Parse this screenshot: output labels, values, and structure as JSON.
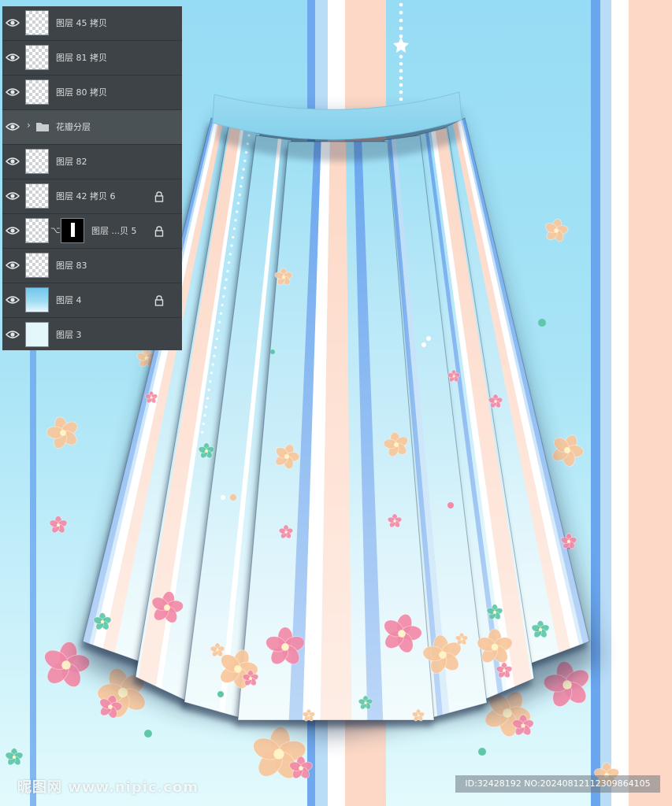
{
  "colors": {
    "sky_blue": "#96dcf4",
    "panel_bg": "#3d4347",
    "stripe_blue": "#6aa6ee",
    "stripe_peach": "#fdd8c6",
    "stripe_white": "#ffffff",
    "flower_pink": "#f28aa8",
    "flower_peach": "#f8c79c",
    "flower_teal": "#5ec7a9"
  },
  "layers_panel": {
    "layers": [
      {
        "name": "图层 45 拷贝",
        "thumbnail": "transparent",
        "locked": false
      },
      {
        "name": "图层 81 拷贝",
        "thumbnail": "transparent",
        "locked": false
      },
      {
        "name": "图层 80 拷贝",
        "thumbnail": "transparent",
        "locked": false
      },
      {
        "name": "花瓣分层",
        "thumbnail": "folder-icon",
        "locked": false,
        "group": true
      },
      {
        "name": "图层 82",
        "thumbnail": "transparent",
        "locked": false
      },
      {
        "name": "图层 42 拷贝 6",
        "thumbnail": "transparent",
        "locked": true
      },
      {
        "name": "图层 ...贝 5",
        "thumbnail": "transparent",
        "locked": true,
        "mask": true
      },
      {
        "name": "图层 83",
        "thumbnail": "transparent",
        "locked": false
      },
      {
        "name": "图层 4",
        "thumbnail": "blue",
        "locked": true
      },
      {
        "name": "图层 3",
        "thumbnail": "pale",
        "locked": false
      }
    ]
  },
  "watermark": {
    "site": "昵图网 www.nipic.com",
    "id_text": "ID:32428192 NO:20240812112309864105"
  }
}
